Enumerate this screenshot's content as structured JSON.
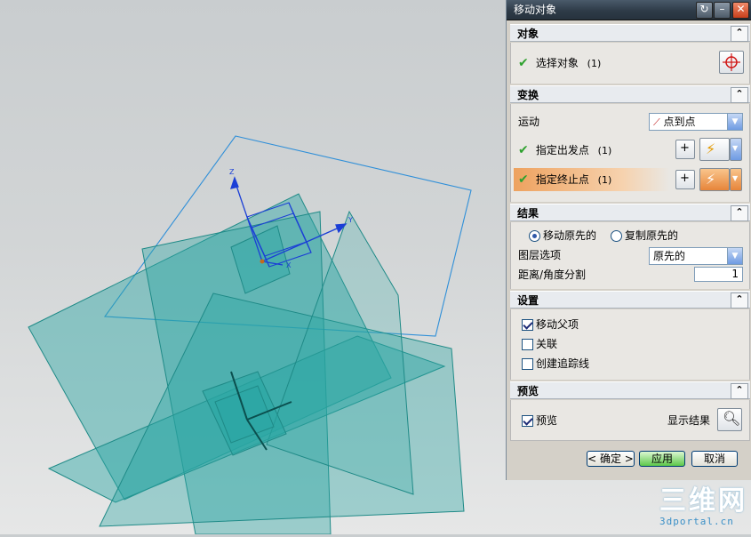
{
  "dialog": {
    "title": "移动对象",
    "object_section": {
      "header": "对象",
      "select_label": "选择对象",
      "select_count": "(1)"
    },
    "transform_section": {
      "header": "变换",
      "motion_label": "运动",
      "motion_value": "点到点",
      "start_point_label": "指定出发点",
      "start_point_count": "(1)",
      "end_point_label": "指定终止点",
      "end_point_count": "(1)"
    },
    "result_section": {
      "header": "结果",
      "move_original": "移动原先的",
      "copy_original": "复制原先的",
      "layer_option_label": "图层选项",
      "layer_option_value": "原先的",
      "distance_label": "距离/角度分割",
      "distance_value": "1"
    },
    "settings_section": {
      "header": "设置",
      "move_parents": "移动父项",
      "associative": "关联",
      "create_trace": "创建追踪线"
    },
    "preview_section": {
      "header": "预览",
      "preview_label": "预览",
      "show_result_label": "显示结果"
    },
    "buttons": {
      "ok": "< 确定 >",
      "apply": "应用",
      "cancel": "取消"
    }
  },
  "viewport": {
    "axis_labels": {
      "z": "Z",
      "y": "Y",
      "x": "X"
    }
  },
  "watermark": {
    "logo": "三维网",
    "site": "3dportal.cn"
  },
  "colors": {
    "sheet_fill": "#2aa6a3",
    "wireframe": "#2f8fd8",
    "title_bar": "#2e3b48",
    "check_green": "#2ea12e",
    "active_row": "#eea25f"
  }
}
